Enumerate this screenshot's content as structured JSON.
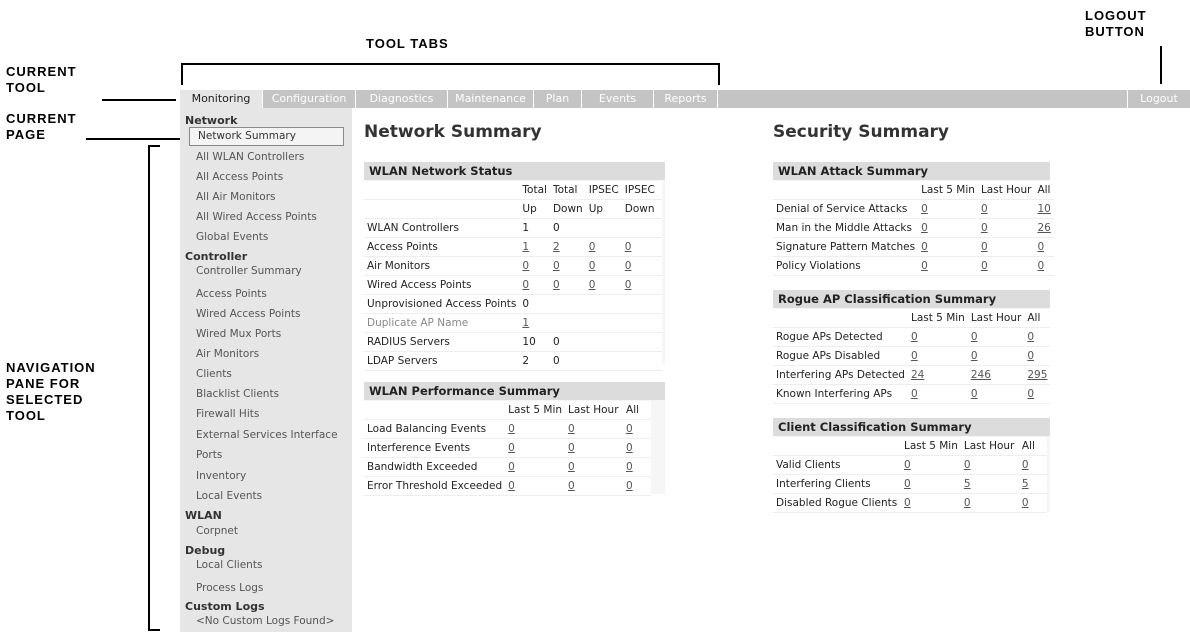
{
  "callouts": {
    "tool_tabs": "Tool Tabs",
    "logout_button_1": "Logout",
    "logout_button_2": "Button",
    "current_tool_1": "Current",
    "current_tool_2": "Tool",
    "current_page_1": "Current",
    "current_page_2": "Page",
    "nav_pane_1": "Navigation",
    "nav_pane_2": "Pane for",
    "nav_pane_3": "Selected",
    "nav_pane_4": "Tool"
  },
  "tabs": [
    "Monitoring",
    "Configuration",
    "Diagnostics",
    "Maintenance",
    "Plan",
    "Events",
    "Reports"
  ],
  "active_tab": "Monitoring",
  "logout_label": "Logout",
  "nav": {
    "network": "Network",
    "network_items": [
      "Network Summary",
      "All WLAN Controllers",
      "All Access Points",
      "All Air Monitors",
      "All Wired Access Points",
      "Global Events"
    ],
    "controller": "Controller",
    "controller_items": [
      "Controller Summary",
      "Access Points",
      "Wired Access Points",
      "Wired Mux Ports",
      "Air Monitors",
      "Clients",
      "Blacklist Clients",
      "Firewall Hits",
      "External Services Interface",
      "Ports",
      "Inventory",
      "Local Events"
    ],
    "wlan": "WLAN",
    "wlan_items": [
      "Corpnet"
    ],
    "debug": "Debug",
    "debug_items": [
      "Local Clients",
      "Process Logs"
    ],
    "custom_logs": "Custom Logs",
    "custom_logs_items": [
      "<No Custom Logs Found>"
    ]
  },
  "network_summary": {
    "title": "Network Summary",
    "status": {
      "title": "WLAN Network Status",
      "head1": [
        "",
        "Total",
        "Total",
        "IPSEC",
        "IPSEC"
      ],
      "head2": [
        "",
        "Up",
        "Down",
        "Up",
        "Down"
      ],
      "rows": [
        [
          "WLAN Controllers",
          "1",
          "0",
          "",
          ""
        ],
        [
          "Access Points",
          "1",
          "2",
          "0",
          "0"
        ],
        [
          "Air Monitors",
          "0",
          "0",
          "0",
          "0"
        ],
        [
          "Wired Access Points",
          "0",
          "0",
          "0",
          "0"
        ],
        [
          "Unprovisioned Access Points",
          "0",
          "",
          "",
          ""
        ],
        [
          "Duplicate AP Name",
          "1",
          "",
          "",
          ""
        ],
        [
          "RADIUS Servers",
          "10",
          "0",
          "",
          ""
        ],
        [
          "LDAP Servers",
          "2",
          "0",
          "",
          ""
        ]
      ]
    },
    "performance": {
      "title": "WLAN Performance Summary",
      "head": [
        "",
        "Last 5 Min",
        "Last Hour",
        "All"
      ],
      "rows": [
        [
          "Load Balancing Events",
          "0",
          "0",
          "0"
        ],
        [
          "Interference Events",
          "0",
          "0",
          "0"
        ],
        [
          "Bandwidth Exceeded",
          "0",
          "0",
          "0"
        ],
        [
          "Error Threshold Exceeded",
          "0",
          "0",
          "0"
        ]
      ]
    }
  },
  "security_summary": {
    "title": "Security Summary",
    "attack": {
      "title": "WLAN Attack Summary",
      "head": [
        "",
        "Last 5 Min",
        "Last Hour",
        "All"
      ],
      "rows": [
        [
          "Denial of Service Attacks",
          "0",
          "0",
          "10"
        ],
        [
          "Man in the Middle Attacks",
          "0",
          "0",
          "26"
        ],
        [
          "Signature Pattern Matches",
          "0",
          "0",
          "0"
        ],
        [
          "Policy Violations",
          "0",
          "0",
          "0"
        ]
      ]
    },
    "rogue": {
      "title": "Rogue AP Classification Summary",
      "head": [
        "",
        "Last 5 Min",
        "Last Hour",
        "All"
      ],
      "rows": [
        [
          "Rogue APs Detected",
          "0",
          "0",
          "0"
        ],
        [
          "Rogue APs Disabled",
          "0",
          "0",
          "0"
        ],
        [
          "Interfering APs Detected",
          "24",
          "246",
          "295"
        ],
        [
          "Known Interfering APs",
          "0",
          "0",
          "0"
        ]
      ]
    },
    "client": {
      "title": "Client Classification Summary",
      "head": [
        "",
        "Last 5 Min",
        "Last Hour",
        "All"
      ],
      "rows": [
        [
          "Valid Clients",
          "0",
          "0",
          "0"
        ],
        [
          "Interfering Clients",
          "0",
          "5",
          "5"
        ],
        [
          "Disabled Rogue Clients",
          "0",
          "0",
          "0"
        ]
      ]
    }
  }
}
